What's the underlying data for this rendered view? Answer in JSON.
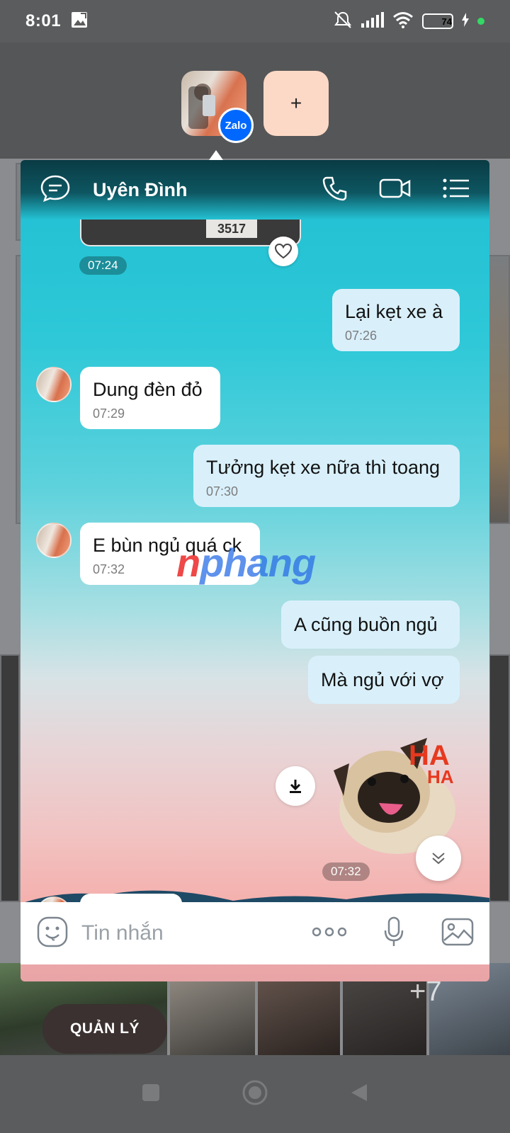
{
  "status_bar": {
    "time": "8:01",
    "battery": "74"
  },
  "bubbles": {
    "app_badge": "Zalo",
    "add_label": "+"
  },
  "background": {
    "more_count": "+7",
    "manage_label": "QUẢN LÝ"
  },
  "chat": {
    "contact_name": "Uyên Đình",
    "image_time": "07:24",
    "plate_text": "3517",
    "messages": [
      {
        "direction": "out",
        "text": "Lại kẹt xe à",
        "time": "07:26"
      },
      {
        "direction": "in",
        "text": "Dung đèn đỏ",
        "time": "07:29"
      },
      {
        "direction": "out",
        "text": "Tưởng kẹt xe nữa thì toang",
        "time": "07:30"
      },
      {
        "direction": "in",
        "text": "E bùn ngủ quá ck",
        "time": "07:32"
      },
      {
        "direction": "out",
        "text": "A cũng buồn ngủ",
        "time": ""
      },
      {
        "direction": "out",
        "text": "Mà ngủ với vợ",
        "time": ""
      }
    ],
    "sticker_time": "07:32",
    "sticker_caption": "HA HA",
    "watermark": "nphang",
    "composer_placeholder": "Tin nhắn"
  },
  "colors": {
    "header_dark": "#0a3b44",
    "outgoing_bubble": "#d9f0fb",
    "incoming_bubble": "#ffffff",
    "zalo_blue": "#0068ff"
  }
}
